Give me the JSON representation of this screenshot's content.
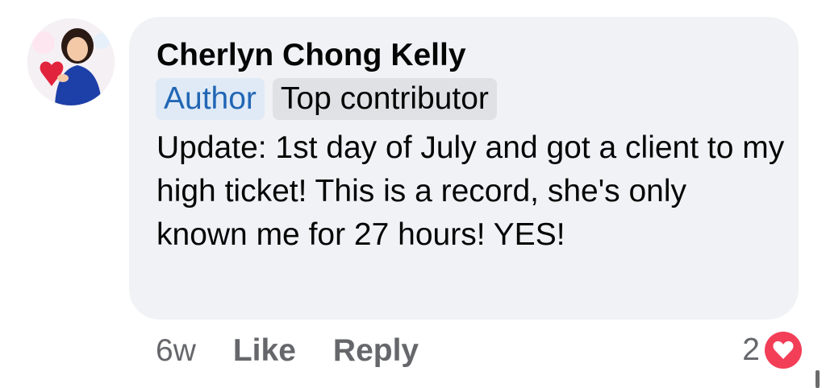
{
  "comment": {
    "author": "Cherlyn Chong Kelly",
    "badges": [
      "Author",
      "Top contributor"
    ],
    "text": "Update: 1st day of July and got a client to my high ticket! This is a record, she's only known me for 27 hours! YES!",
    "time": "6w",
    "actions": {
      "like": "Like",
      "reply": "Reply"
    },
    "reaction_count": "2",
    "reaction_icon": "heart-icon"
  },
  "colors": {
    "bubble": "#f0f2f5",
    "author_badge_bg": "#dfeaf6",
    "author_badge_text": "#2166b5",
    "heart": "#f33e58"
  }
}
